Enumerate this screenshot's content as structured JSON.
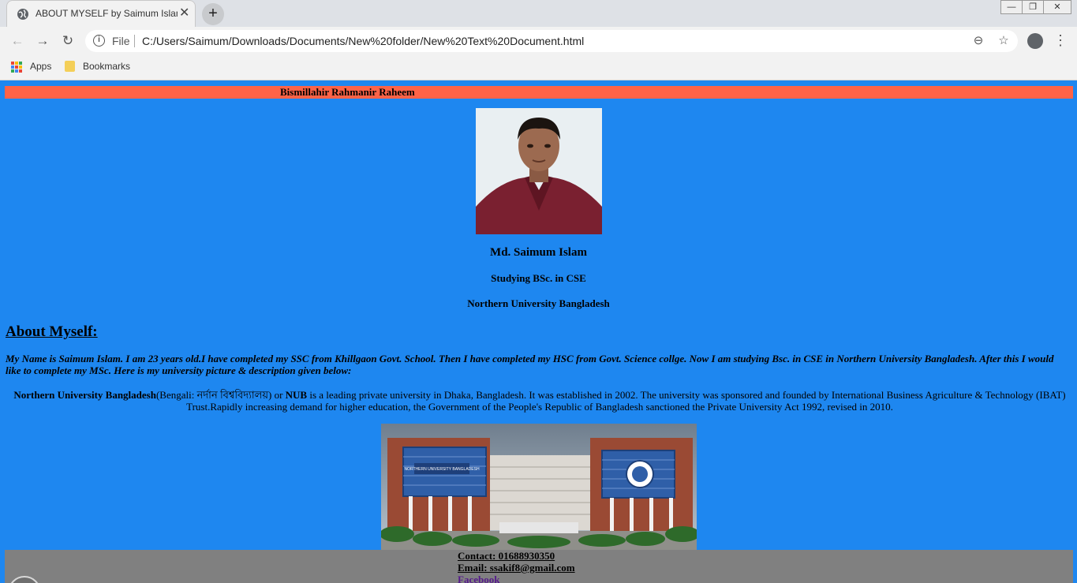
{
  "browser": {
    "tab_title": "ABOUT MYSELF by Saimum Islam",
    "tab_close": "✕",
    "new_tab": "+",
    "window_controls": [
      "—",
      "❐",
      "✕"
    ],
    "file_label": "File",
    "url": "C:/Users/Saimum/Downloads/Documents/New%20folder/New%20Text%20Document.html",
    "bookmarks": [
      {
        "label": "Apps",
        "icon": "apps-grid-icon"
      },
      {
        "label": "Bookmarks",
        "icon": "folder-icon"
      }
    ]
  },
  "page": {
    "banner": "Bismillahir Rahmanir Raheem",
    "name": "Md. Saimum Islam",
    "study": "Studying BSc. in CSE",
    "university": "Northern University Bangladesh",
    "about_heading": "About Myself:",
    "intro": "My Name is Saimum Islam. I am 23 years old.I have completed my SSC from Khillgaon Govt. School. Then I have completed my HSC from Govt. Science collge. Now I am studying Bsc. in CSE in Northern University Bangladesh. After this I would like to complete my MSc. Here is my university picture & description given below:",
    "desc": {
      "uni_bold": "Northern University Bangladesh",
      "part1": "(Bengali: নর্দান বিশ্ববিদ্যালয়) or ",
      "nub_bold": "NUB",
      "part2": " is a leading private university in Dhaka, Bangladesh. It was established in 2002. The university was sponsored and founded by International Business Agriculture & Technology (IBAT) Trust.Rapidly increasing demand for higher education, the Government of the People's Republic of Bangladesh sanctioned the Private University Act 1992, revised in 2010."
    },
    "campus_sign": "NORTHERN UNIVERSITY BANGLADESH",
    "contact": "Contact: 01688930350",
    "email": "Email: ssakif8@gmail.com",
    "facebook": "Facebook"
  },
  "colors": {
    "page_bg": "#1e87f0",
    "banner_bg": "#ff6347",
    "footer_bg": "#808080",
    "link_visited": "#551a8b"
  }
}
